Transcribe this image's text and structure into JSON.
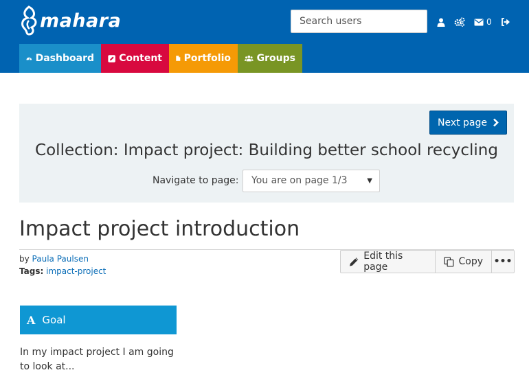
{
  "header": {
    "logo_text": "mahara",
    "search_placeholder": "Search users",
    "mail_count": "0",
    "icons": [
      "user-icon",
      "cogs-icon",
      "envelope-icon",
      "logout-icon"
    ]
  },
  "nav": {
    "tabs": [
      {
        "label": "Dashboard",
        "icon": "tachometer-icon",
        "color": "#1a8fc9"
      },
      {
        "label": "Content",
        "icon": "pencil-square-icon",
        "color": "#d8093f"
      },
      {
        "label": "Portfolio",
        "icon": "file-icon",
        "color": "#f59a06"
      },
      {
        "label": "Groups",
        "icon": "users-icon",
        "color": "#799524"
      }
    ]
  },
  "collection_nav": {
    "next_label": "Next page",
    "title": "Collection: Impact project: Building better school recycling",
    "navigate_label": "Navigate to page:",
    "select_value": "You are on page 1/3"
  },
  "page": {
    "title": "Impact project introduction",
    "by_prefix": "by",
    "author": "Paula Paulsen",
    "tags_label": "Tags:",
    "tag": "impact-project",
    "edit_label": "Edit this page",
    "copy_label": "Copy",
    "more_label": "•••"
  },
  "block": {
    "icon_letter": "A",
    "title": "Goal",
    "text": "In my impact project I am going to look at..."
  }
}
